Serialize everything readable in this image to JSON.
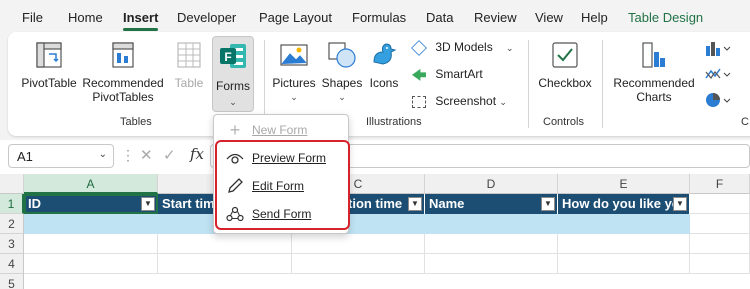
{
  "menubar": {
    "items": [
      {
        "label": "File"
      },
      {
        "label": "Home"
      },
      {
        "label": "Insert"
      },
      {
        "label": "Developer"
      },
      {
        "label": "Page Layout"
      },
      {
        "label": "Formulas"
      },
      {
        "label": "Data"
      },
      {
        "label": "Review"
      },
      {
        "label": "View"
      },
      {
        "label": "Help"
      },
      {
        "label": "Table Design"
      }
    ],
    "active": "Insert",
    "contextual_color": "#217346"
  },
  "ribbon": {
    "tables": {
      "pivottable": "PivotTable",
      "recommended_line1": "Recommended",
      "recommended_line2": "PivotTables",
      "table": "Table",
      "forms": "Forms",
      "group": "Tables"
    },
    "illustrations": {
      "pictures": "Pictures",
      "shapes": "Shapes",
      "icons": "Icons",
      "models_3d": "3D Models",
      "smartart": "SmartArt",
      "screenshot": "Screenshot",
      "group": "Illustrations"
    },
    "controls": {
      "checkbox": "Checkbox",
      "group": "Controls"
    },
    "charts": {
      "recommended_line1": "Recommended",
      "recommended_line2": "Charts",
      "group_partial": "C"
    }
  },
  "forms_menu": {
    "new_form": "New Form",
    "preview_form": "Preview Form",
    "edit_form": "Edit Form",
    "send_form": "Send Form"
  },
  "formula_bar": {
    "name_box": "A1",
    "fx": "fx"
  },
  "sheet": {
    "columns": [
      "A",
      "B",
      "C",
      "D",
      "E",
      "F"
    ],
    "rows": [
      "1",
      "2",
      "3",
      "4",
      "5"
    ],
    "table_headers": [
      "ID",
      "Start tim",
      "tion time",
      "Name",
      "How do you like yo"
    ],
    "header_color": "#1c4e74",
    "band_color": "#bfe3f3"
  }
}
